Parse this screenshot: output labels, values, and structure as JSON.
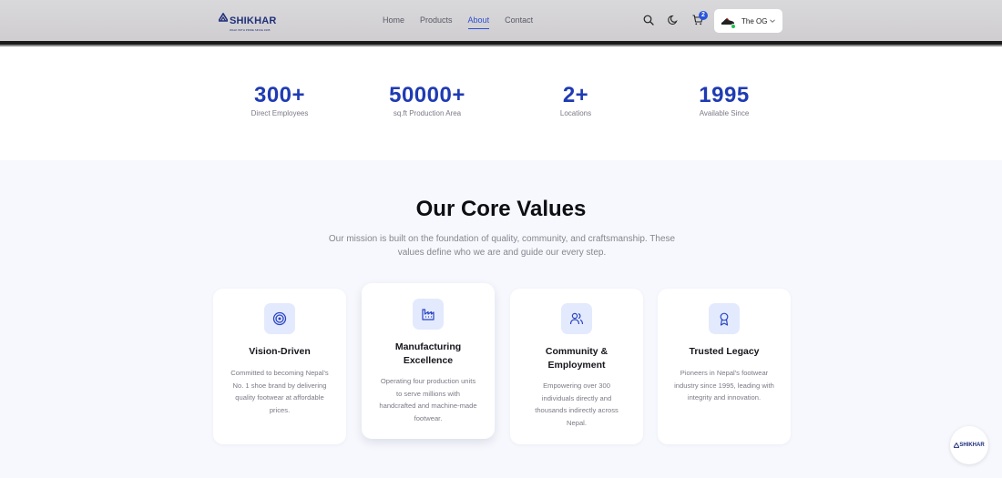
{
  "brand": {
    "name": "SHIKHAR",
    "tagline": "WALK WITH PRIDE SINCE 1995"
  },
  "nav": {
    "items": [
      "Home",
      "Products",
      "About",
      "Contact"
    ],
    "active": "About"
  },
  "header": {
    "cart_count": "2",
    "profile_name": "The OG"
  },
  "stats": [
    {
      "value": "300+",
      "label": "Direct Employees"
    },
    {
      "value": "50000+",
      "label": "sq.ft Production Area"
    },
    {
      "value": "2+",
      "label": "Locations"
    },
    {
      "value": "1995",
      "label": "Available Since"
    }
  ],
  "values": {
    "title": "Our Core Values",
    "subtitle": "Our mission is built on the foundation of quality, community, and craftsmanship. These values define who we are and guide our every step.",
    "cards": [
      {
        "icon": "target-icon",
        "title": "Vision-Driven",
        "description": "Committed to becoming Nepal's No. 1 shoe brand by delivering quality footwear at affordable prices."
      },
      {
        "icon": "factory-icon",
        "title": "Manufacturing Excellence",
        "description": "Operating four production units to serve millions with handcrafted and machine-made footwear."
      },
      {
        "icon": "users-icon",
        "title": "Community & Employment",
        "description": "Empowering over 300 individuals directly and thousands indirectly across Nepal."
      },
      {
        "icon": "award-icon",
        "title": "Trusted Legacy",
        "description": "Pioneers in Nepal's footwear industry since 1995, leading with integrity and innovation."
      }
    ]
  },
  "colors": {
    "accent": "#1f3bb3",
    "link_active": "#2f4fd0",
    "icon_bg": "#e3eafd",
    "section_bg": "#f7f8fd"
  }
}
